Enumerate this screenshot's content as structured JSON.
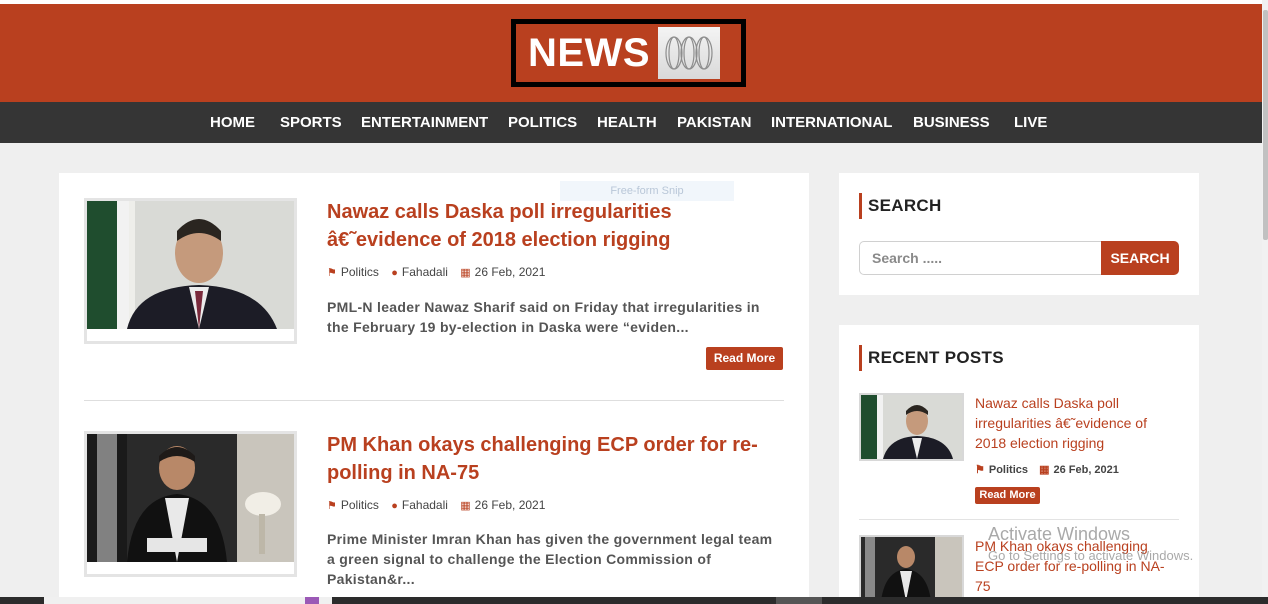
{
  "brand": {
    "logo_text": "NEWS",
    "logo_icon": "news-network-logo-icon",
    "accent_color": "#b9401f",
    "nav_bg": "#353535"
  },
  "nav": {
    "items": [
      {
        "label": "HOME"
      },
      {
        "label": "SPORTS"
      },
      {
        "label": "ENTERTAINMENT"
      },
      {
        "label": "POLITICS"
      },
      {
        "label": "HEALTH"
      },
      {
        "label": "PAKISTAN"
      },
      {
        "label": "INTERNATIONAL"
      },
      {
        "label": "BUSINESS"
      },
      {
        "label": "LIVE"
      }
    ]
  },
  "overlay": {
    "snip_label": "Free-form Snip"
  },
  "posts": [
    {
      "title": "Nawaz calls Daska poll irregularities â€˜evidence of 2018 election rigging",
      "category": "Politics",
      "author": "Fahadali",
      "date": "26 Feb, 2021",
      "excerpt": "PML-N leader Nawaz Sharif said on Friday that irregularities in the February 19 by-election in Daska were “eviden...",
      "read_more": "Read More",
      "image": "nawaz-sharif-photo"
    },
    {
      "title": "PM Khan okays challenging ECP order for re-polling in NA-75",
      "category": "Politics",
      "author": "Fahadali",
      "date": "26 Feb, 2021",
      "excerpt": "Prime Minister Imran Khan has given the government legal team a green signal to challenge the Election Commission of Pakistan&r...",
      "read_more": "Read More",
      "image": "imran-khan-photo"
    }
  ],
  "sidebar": {
    "search": {
      "heading": "SEARCH",
      "placeholder": "Search .....",
      "button_label": "SEARCH"
    },
    "recent": {
      "heading": "RECENT POSTS",
      "items": [
        {
          "title": "Nawaz calls Daska poll irregularities â€˜evidence of 2018 election rigging",
          "category": "Politics",
          "date": "26 Feb, 2021",
          "read_more": "Read More"
        },
        {
          "title": "PM Khan okays challenging ECP order for re-polling in NA-75"
        }
      ]
    }
  },
  "watermark": {
    "line1": "Activate Windows",
    "line2": "Go to Settings to activate Windows."
  }
}
